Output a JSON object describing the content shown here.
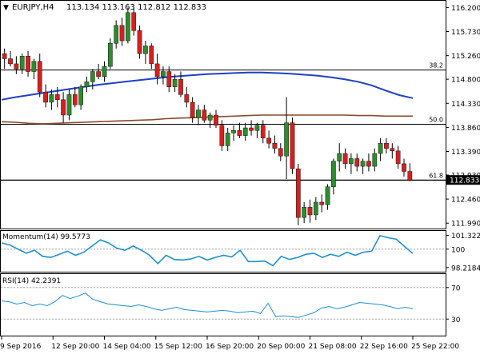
{
  "window": {
    "symbol_label": "EURJPY,H4",
    "ohlc_label": "113.134 113.163 112.812 112.833",
    "collapse_icon": "triangle-down-icon"
  },
  "colors": {
    "bull_body": "#2e8b2e",
    "bear_body": "#d42020",
    "ma_fast": "#1e3fc8",
    "ma_slow": "#8b4a2a",
    "indicator_line": "#1e90d0",
    "level_line": "#000000",
    "price_tag_bg": "#000000",
    "price_tag_text": "#ffffff",
    "grid_border": "#000000"
  },
  "chart_data": [
    {
      "type": "candlestick",
      "title": "EURJPY,H4",
      "price_axis_ticks": [
        "116.200",
        "115.730",
        "115.260",
        "114.800",
        "114.330",
        "113.860",
        "113.390",
        "112.930",
        "112.460",
        "111.990"
      ],
      "ylim": [
        111.9,
        116.3
      ],
      "current_price": "112.833",
      "x_tick_labels": [
        "9 Sep 2016",
        "12 Sep 20:00",
        "14 Sep 04:00",
        "15 Sep 12:00",
        "16 Sep 20:00",
        "20 Sep 00:00",
        "21 Sep 08:00",
        "22 Sep 16:00",
        "25 Sep 22:00"
      ],
      "levels": [
        {
          "label": "38.2",
          "value": 114.98
        },
        {
          "label": "50.0",
          "value": 113.92
        },
        {
          "label": "61.8",
          "value": 112.83
        }
      ],
      "candles": [
        [
          115.3,
          115.4,
          115.0,
          115.2
        ],
        [
          115.2,
          115.35,
          115.05,
          115.1
        ],
        [
          115.1,
          115.25,
          114.9,
          115.0
        ],
        [
          115.0,
          115.3,
          114.9,
          115.25
        ],
        [
          115.25,
          115.35,
          114.85,
          114.95
        ],
        [
          114.95,
          115.2,
          114.8,
          115.15
        ],
        [
          115.15,
          115.3,
          114.45,
          114.55
        ],
        [
          114.55,
          114.7,
          114.25,
          114.35
        ],
        [
          114.35,
          114.6,
          114.2,
          114.5
        ],
        [
          114.5,
          114.65,
          114.25,
          114.4
        ],
        [
          114.4,
          114.55,
          113.95,
          114.1
        ],
        [
          114.1,
          114.6,
          114.0,
          114.5
        ],
        [
          114.5,
          114.65,
          114.25,
          114.3
        ],
        [
          114.3,
          114.7,
          114.2,
          114.65
        ],
        [
          114.65,
          114.85,
          114.55,
          114.75
        ],
        [
          114.75,
          115.0,
          114.6,
          114.95
        ],
        [
          114.95,
          115.1,
          114.8,
          114.85
        ],
        [
          114.85,
          115.15,
          114.75,
          115.05
        ],
        [
          115.05,
          115.6,
          115.0,
          115.5
        ],
        [
          115.5,
          115.95,
          115.4,
          115.85
        ],
        [
          115.85,
          116.0,
          115.45,
          115.55
        ],
        [
          115.55,
          116.2,
          115.5,
          116.1
        ],
        [
          116.1,
          116.2,
          115.65,
          115.75
        ],
        [
          115.75,
          115.85,
          115.2,
          115.3
        ],
        [
          115.3,
          115.55,
          115.1,
          115.45
        ],
        [
          115.45,
          115.5,
          115.0,
          115.1
        ],
        [
          115.1,
          115.3,
          114.7,
          114.85
        ],
        [
          114.85,
          115.05,
          114.7,
          114.95
        ],
        [
          114.95,
          115.05,
          114.55,
          114.65
        ],
        [
          114.65,
          114.9,
          114.55,
          114.8
        ],
        [
          114.8,
          114.95,
          114.45,
          114.5
        ],
        [
          114.5,
          114.65,
          114.25,
          114.35
        ],
        [
          114.35,
          114.45,
          113.95,
          114.05
        ],
        [
          114.05,
          114.3,
          113.9,
          114.2
        ],
        [
          114.2,
          114.3,
          113.95,
          114.0
        ],
        [
          114.0,
          114.15,
          113.85,
          114.1
        ],
        [
          114.1,
          114.2,
          113.85,
          113.9
        ],
        [
          113.9,
          114.0,
          113.4,
          113.5
        ],
        [
          113.5,
          113.85,
          113.4,
          113.75
        ],
        [
          113.75,
          113.9,
          113.6,
          113.8
        ],
        [
          113.8,
          113.95,
          113.65,
          113.7
        ],
        [
          113.7,
          113.95,
          113.6,
          113.85
        ],
        [
          113.85,
          114.0,
          113.7,
          113.8
        ],
        [
          113.8,
          113.95,
          113.65,
          113.9
        ],
        [
          113.9,
          114.0,
          113.55,
          113.65
        ],
        [
          113.65,
          113.8,
          113.45,
          113.55
        ],
        [
          113.55,
          113.7,
          113.35,
          113.45
        ],
        [
          113.45,
          113.55,
          113.2,
          113.3
        ],
        [
          113.3,
          114.45,
          112.85,
          113.95
        ],
        [
          113.95,
          114.05,
          112.95,
          113.05
        ],
        [
          113.05,
          113.15,
          111.95,
          112.1
        ],
        [
          112.1,
          112.4,
          111.99,
          112.3
        ],
        [
          112.3,
          112.45,
          112.0,
          112.15
        ],
        [
          112.15,
          112.5,
          112.05,
          112.4
        ],
        [
          112.4,
          112.55,
          112.2,
          112.35
        ],
        [
          112.35,
          112.75,
          112.25,
          112.7
        ],
        [
          112.7,
          113.25,
          112.55,
          113.2
        ],
        [
          113.2,
          113.55,
          113.0,
          113.35
        ],
        [
          113.35,
          113.45,
          113.05,
          113.15
        ],
        [
          113.15,
          113.35,
          112.95,
          113.25
        ],
        [
          113.25,
          113.35,
          113.0,
          113.1
        ],
        [
          113.1,
          113.25,
          112.95,
          113.2
        ],
        [
          113.2,
          113.35,
          113.0,
          113.1
        ],
        [
          113.1,
          113.45,
          113.0,
          113.35
        ],
        [
          113.35,
          113.65,
          113.2,
          113.55
        ],
        [
          113.55,
          113.65,
          113.35,
          113.45
        ],
        [
          113.45,
          113.55,
          113.25,
          113.4
        ],
        [
          113.4,
          113.5,
          113.05,
          113.15
        ],
        [
          113.15,
          113.25,
          112.9,
          113.0
        ],
        [
          113.0,
          113.16,
          112.81,
          112.83
        ]
      ],
      "moving_averages": [
        {
          "role": "fast",
          "values": [
            114.4,
            114.45,
            114.49,
            114.53,
            114.57,
            114.61,
            114.65,
            114.69,
            114.72,
            114.75,
            114.78,
            114.81,
            114.84,
            114.86,
            114.88,
            114.9,
            114.91,
            114.92,
            114.93,
            114.93,
            114.92,
            114.91,
            114.89,
            114.87,
            114.84,
            114.8,
            114.75,
            114.68,
            114.58,
            114.49,
            114.43
          ]
        },
        {
          "role": "slow",
          "values": [
            113.97,
            113.96,
            113.94,
            113.93,
            113.94,
            113.95,
            113.96,
            113.97,
            113.98,
            113.99,
            114.0,
            114.01,
            114.03,
            114.04,
            114.05,
            114.06,
            114.07,
            114.08,
            114.09,
            114.1,
            114.1,
            114.1,
            114.1,
            114.1,
            114.1,
            114.1,
            114.09,
            114.09,
            114.08,
            114.08,
            114.08
          ]
        }
      ]
    },
    {
      "type": "line",
      "title": "Momentum(14) 99.5773",
      "y_tick_labels": [
        "101.3229",
        "100",
        "98.2184"
      ],
      "ylim": [
        97.9,
        101.6
      ],
      "reference_level": 100,
      "values": [
        100.6,
        100.4,
        100.0,
        99.6,
        99.9,
        99.3,
        99.2,
        99.5,
        99.8,
        99.4,
        99.7,
        100.3,
        100.9,
        100.6,
        100.1,
        99.9,
        100.3,
        99.9,
        99.4,
        98.6,
        99.4,
        99.0,
        98.95,
        99.05,
        99.3,
        98.95,
        99.2,
        99.4,
        99.25,
        99.9,
        98.8,
        98.8,
        98.85,
        98.4,
        99.3,
        99.0,
        99.2,
        99.5,
        99.6,
        99.2,
        99.5,
        99.3,
        99.7,
        99.4,
        99.7,
        99.8,
        101.3,
        101.1,
        100.95,
        100.25,
        99.58
      ]
    },
    {
      "type": "line",
      "title": "RSI(14) 42.2391",
      "y_tick_labels": [
        "70",
        "30"
      ],
      "ylim": [
        10,
        85
      ],
      "reference_levels": [
        70,
        30
      ],
      "values": [
        53,
        52,
        49,
        51,
        47,
        49,
        47,
        52,
        60,
        56,
        59,
        63,
        55,
        52,
        49,
        48,
        47,
        46,
        48,
        46,
        43,
        41,
        43,
        45,
        42,
        41,
        40,
        39,
        40,
        41,
        40,
        38,
        39,
        40,
        37,
        50,
        33,
        34,
        33,
        32,
        35,
        38,
        44,
        46,
        43,
        45,
        48,
        51,
        50,
        49,
        48,
        46,
        43,
        45,
        43
      ]
    }
  ]
}
